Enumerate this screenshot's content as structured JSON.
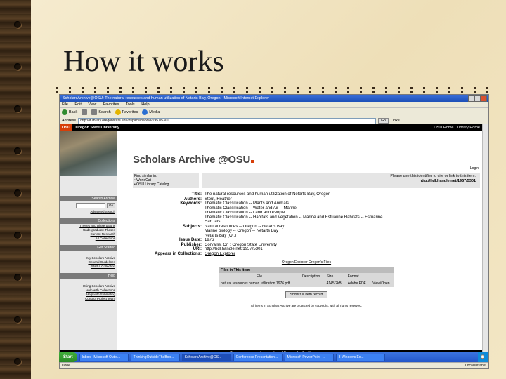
{
  "slide": {
    "title": "How it works"
  },
  "browser": {
    "window_title": "ScholarsArchive@OSU: The natural resources and human utilization of Netarts Bay, Oregon - Microsoft Internet Explorer",
    "menu": [
      "File",
      "Edit",
      "View",
      "Favorites",
      "Tools",
      "Help"
    ],
    "toolbar": [
      "Back",
      "Search",
      "Favorites",
      "Media"
    ],
    "address_label": "Address",
    "address": "http://ir.library.oregonstate.edu/dspace/handle/1957/5301",
    "go_label": "Go",
    "links_label": "Links"
  },
  "site": {
    "osu_logo": "OSU",
    "osu_name": "Oregon State University",
    "osu_right": "OSU Home | Library Home",
    "archive_logo": "Scholars Archive @OSU",
    "login": "Login",
    "sidebar": {
      "search_head": "Search Archive",
      "go": "Go",
      "advanced": "Advanced Search",
      "collections_head": "Collections",
      "collections_links": [
        "Theses and Dissertations",
        "Undergraduate Theses",
        "Current Research",
        "All Collections"
      ],
      "started_head": "Get Started",
      "started_links": [
        "My Scholars Archive",
        "General Guidelines",
        "Start a Collection"
      ],
      "help_head": "Help",
      "help_links": [
        "Using Scholars Archive",
        "Help with Collections",
        "Help with Submitting",
        "Contact Project Team"
      ]
    },
    "find_similar": {
      "title": "Find similar in:",
      "items": [
        "WorldCat",
        "OSU Library Catalog"
      ]
    },
    "identifier": {
      "line1": "Please use this identifier to cite or link to this item:",
      "line2": "http://hdl.handle.net/1957/5301"
    },
    "metadata": [
      {
        "k": "Title:",
        "v": "The natural resources and human utilization of Netarts Bay, Oregon"
      },
      {
        "k": "Authors:",
        "v": "Stout, Heather"
      },
      {
        "k": "Keywords:",
        "v": "Thematic Classification -- Plants and Animals"
      },
      {
        "k": "",
        "v": "Thematic Classification -- Water and Air -- Marine"
      },
      {
        "k": "",
        "v": "Thematic Classification -- Land and People"
      },
      {
        "k": "",
        "v": "Thematic Classification -- Habitats and Vegetation -- Marine and Estuarine Habitats -- Estuarine"
      },
      {
        "k": "",
        "v": "Hab tats"
      },
      {
        "k": "Subjects:",
        "v": "Natural resources -- Oregon -- Netarts Bay"
      },
      {
        "k": "",
        "v": "Marine biology -- Oregon -- Netarts Bay"
      },
      {
        "k": "",
        "v": "Netarts Bay (Or.)"
      },
      {
        "k": "Issue Date:",
        "v": "1976"
      },
      {
        "k": "Publisher:",
        "v": "Corvallis, Or. : Oregon State University"
      },
      {
        "k": "URI:",
        "v": "http://hdl.handle.net/1957/5301"
      },
      {
        "k": "Appears in Collections:",
        "v": "Oregon Explorer"
      }
    ],
    "mirror_link": "Oregon Explorer Oregon's Files",
    "files": {
      "head": "Files in This Item:",
      "columns": [
        "File",
        "Description",
        "Size",
        "Format"
      ],
      "rows": [
        [
          "natural resources human utilization 1976.pdf",
          "",
          "4145.2kB",
          "Adobe PDF"
        ]
      ],
      "view": "View/Open"
    },
    "show_full": "Show full item record",
    "copyright": "All items in Scholars Archive are protected by copyright, with all rights reserved.",
    "footer": "Give comments and suggestions | System Availability"
  },
  "status": {
    "left": "Done",
    "right": "Local intranet"
  },
  "taskbar": {
    "start": "Start",
    "tasks": [
      "Inbox - Microsoft Outlo...",
      "ThinkingOutsideTheBox...",
      "ScholarsArchive@OS...",
      "Conference Presentation...",
      "Microsoft PowerPoint -...",
      "3 Windows Ex..."
    ],
    "clock": ""
  }
}
